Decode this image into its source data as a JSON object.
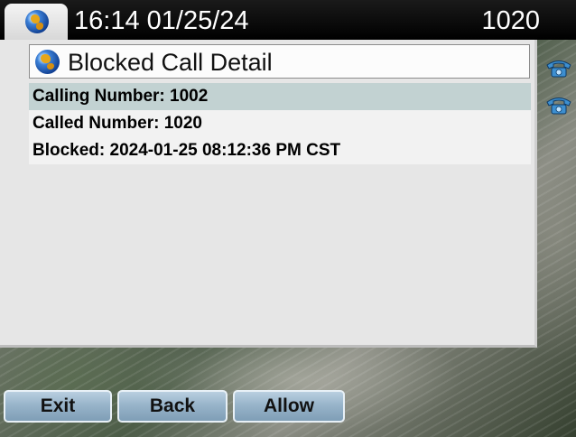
{
  "status_bar": {
    "datetime": "16:14 01/25/24",
    "extension": "1020",
    "tab_icon": "globe-icon"
  },
  "line_keys": [
    {
      "icon": "phone-icon"
    },
    {
      "icon": "phone-icon"
    }
  ],
  "window": {
    "title": "Blocked Call Detail",
    "title_icon": "globe-icon",
    "rows": [
      {
        "text": "Calling Number: 1002",
        "selected": true
      },
      {
        "text": "Called Number: 1020",
        "selected": false
      },
      {
        "text": "Blocked: 2024-01-25 08:12:36 PM CST",
        "selected": false
      }
    ]
  },
  "softkeys": {
    "exit": "Exit",
    "back": "Back",
    "allow": "Allow"
  },
  "colors": {
    "selected_row": "#c2d2d2",
    "softkey": "#98b4ca",
    "status_bar": "#000000"
  }
}
